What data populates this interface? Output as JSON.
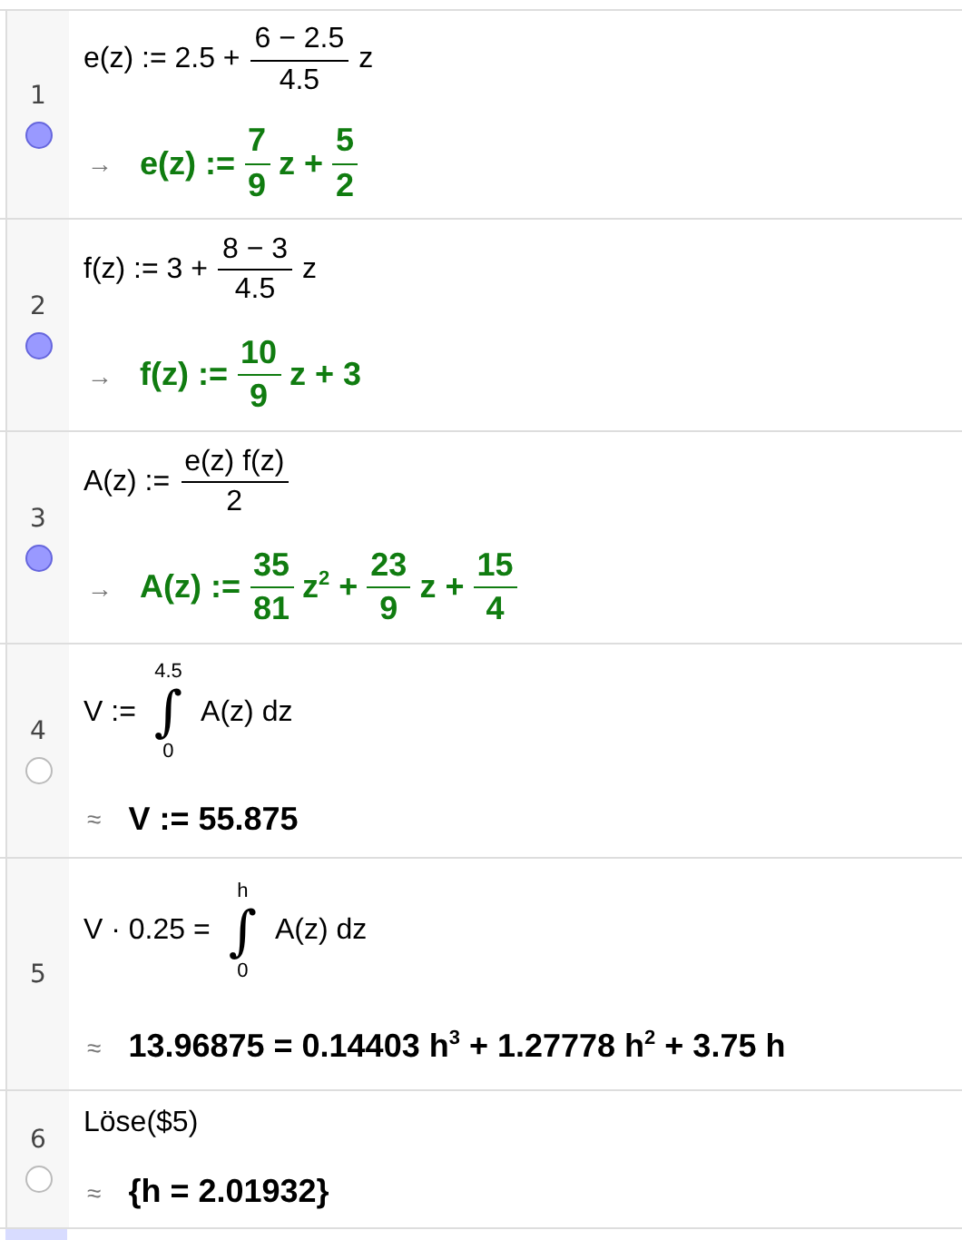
{
  "rows": [
    {
      "number": "1",
      "toggle": {
        "on": true
      },
      "input": [
        {
          "kind": "text",
          "text": "e(z) := 2.5 +"
        },
        {
          "kind": "frac",
          "num": "6 − 2.5",
          "den": "4.5"
        },
        {
          "kind": "text",
          "text": "z"
        }
      ],
      "output": {
        "prefix": "→",
        "color": "#107c10",
        "parts": [
          {
            "kind": "text",
            "text": "e(z) :="
          },
          {
            "kind": "frac",
            "num": "7",
            "den": "9"
          },
          {
            "kind": "text",
            "text": "z +"
          },
          {
            "kind": "frac",
            "num": "5",
            "den": "2"
          }
        ]
      }
    },
    {
      "number": "2",
      "toggle": {
        "on": true
      },
      "input": [
        {
          "kind": "text",
          "text": "f(z) := 3 +"
        },
        {
          "kind": "frac",
          "num": "8 − 3",
          "den": "4.5"
        },
        {
          "kind": "text",
          "text": "z"
        }
      ],
      "output": {
        "prefix": "→",
        "color": "#107c10",
        "parts": [
          {
            "kind": "text",
            "text": "f(z) :="
          },
          {
            "kind": "frac",
            "num": "10",
            "den": "9"
          },
          {
            "kind": "text",
            "text": "z + 3"
          }
        ]
      }
    },
    {
      "number": "3",
      "toggle": {
        "on": true
      },
      "input": [
        {
          "kind": "text",
          "text": "A(z) :="
        },
        {
          "kind": "frac",
          "num": "e(z) f(z)",
          "den": "2"
        }
      ],
      "output": {
        "prefix": "→",
        "color": "#107c10",
        "parts": [
          {
            "kind": "text",
            "text": "A(z) :="
          },
          {
            "kind": "frac",
            "num": "35",
            "den": "81"
          },
          {
            "kind": "text",
            "text": "z$^{2}$ +"
          },
          {
            "kind": "frac",
            "num": "23",
            "den": "9"
          },
          {
            "kind": "text",
            "text": "z +"
          },
          {
            "kind": "frac",
            "num": "15",
            "den": "4"
          }
        ]
      }
    },
    {
      "number": "4",
      "toggle": {
        "on": false
      },
      "input": [
        {
          "kind": "text",
          "text": "V :="
        },
        {
          "kind": "integral",
          "sign": "∫",
          "upper": "4.5",
          "lower": "0"
        },
        {
          "kind": "text",
          "text": "A(z) dz"
        }
      ],
      "output": {
        "prefix": "≈",
        "color": "#000000",
        "parts": [
          {
            "kind": "text",
            "text": "V := 55.875"
          }
        ]
      }
    },
    {
      "number": "5",
      "input": [
        {
          "kind": "text",
          "text": "V · 0.25 ="
        },
        {
          "kind": "integral",
          "sign": "∫",
          "upper": "h",
          "lower": "0"
        },
        {
          "kind": "text",
          "text": "A(z) dz"
        }
      ],
      "output": {
        "prefix": "≈",
        "color": "#000000",
        "parts": [
          {
            "kind": "text",
            "text": "13.96875 = 0.14403 h$^{3}$ + 1.27778 h$^{2}$ + 3.75 h"
          }
        ]
      }
    },
    {
      "number": "6",
      "toggle": {
        "on": false
      },
      "input": [
        {
          "kind": "text",
          "text": "Löse($5)"
        }
      ],
      "output": {
        "prefix": "≈",
        "color": "#000000",
        "parts": [
          {
            "kind": "text",
            "text": "{h = 2.01932}"
          }
        ]
      }
    }
  ]
}
